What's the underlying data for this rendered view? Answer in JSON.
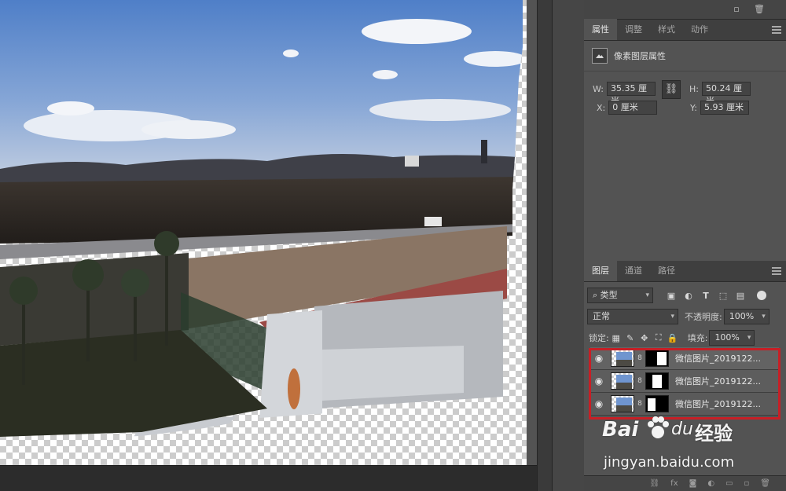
{
  "properties": {
    "tabs": [
      {
        "label": "属性"
      },
      {
        "label": "调整"
      },
      {
        "label": "样式"
      },
      {
        "label": "动作"
      }
    ],
    "header": "像素图层属性",
    "w_label": "W:",
    "w_value": "35.35 厘米",
    "h_label": "H:",
    "h_value": "50.24 厘米",
    "x_label": "X:",
    "x_value": "0 厘米",
    "y_label": "Y:",
    "y_value": "5.93 厘米"
  },
  "layers": {
    "tabs": [
      {
        "label": "图层"
      },
      {
        "label": "通道"
      },
      {
        "label": "路径"
      }
    ],
    "filter_label": "类型",
    "blend_mode": "正常",
    "opacity_label": "不透明度:",
    "opacity_value": "100%",
    "lock_label": "锁定:",
    "fill_label": "填充:",
    "fill_value": "100%",
    "items": [
      {
        "name": "微信图片_2019122..."
      },
      {
        "name": "微信图片_2019122..."
      },
      {
        "name": "微信图片_2019122..."
      }
    ]
  },
  "watermark": {
    "brand": "Bai",
    "brand_suffix": "du",
    "product": "经验",
    "url": "jingyan.baidu.com"
  },
  "colors": {
    "panel_bg": "#535353",
    "highlight_border": "#c71f26",
    "sky": "#6f95cf"
  }
}
